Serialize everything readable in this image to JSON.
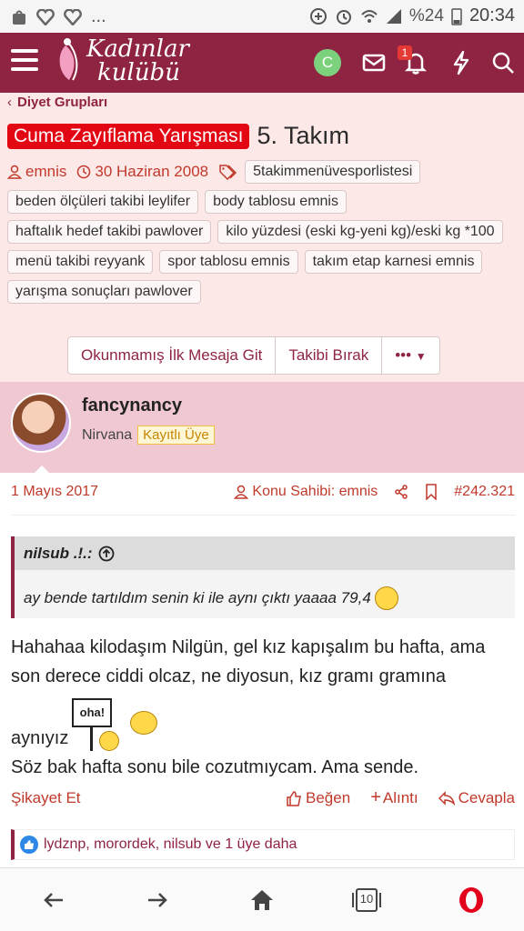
{
  "status_bar": {
    "battery": "%24",
    "time": "20:34"
  },
  "app": {
    "logo_line1": "Kadınlar",
    "logo_line2": "kulübü",
    "avatar_letter": "C",
    "notification_count": "1"
  },
  "breadcrumb": "Diyet Grupları",
  "thread": {
    "prefix": "Cuma Zayıflama Yarışması",
    "title": "5. Takım",
    "author": "emnis",
    "date": "30 Haziran 2008",
    "tags": [
      "5takimmenüvesporlistesi",
      "beden ölçüleri takibi leylifer",
      "body tablosu emnis",
      "haftalık hedef takibi pawlover",
      "kilo yüzdesi (eski kg-yeni kg)/eski kg *100",
      "menü takibi reyyank",
      "spor tablosu emnis",
      "takım etap karnesi emnis",
      "yarışma sonuçları pawlover"
    ],
    "buttons": {
      "unread": "Okunmamış İlk Mesaja Git",
      "unwatch": "Takibi Bırak",
      "more": "•••"
    }
  },
  "post": {
    "username": "fancynancy",
    "user_title": "Nirvana",
    "user_badge": "Kayıtlı Üye",
    "date": "1 Mayıs 2017",
    "thread_starter": "Konu Sahibi: emnis",
    "post_number": "#242.321",
    "quote_author": "nilsub .!.:",
    "quote_text": "ay bende tartıldım senin ki ile aynı çıktı yaaaa 79,4",
    "body_line1": "Hahahaa kilodaşım Nilgün, gel kız kapışalım bu hafta, ama son derece ciddi olcaz, ne diyosun, kız gramı gramına",
    "body_line2": "aynıyız",
    "body_line3": "Söz bak hafta sonu bile cozutmıycam. Ama sende.",
    "sign_text": "oha!",
    "report": "Şikayet Et",
    "like": "Beğen",
    "quote_btn": "Alıntı",
    "reply": "Cevapla",
    "likes_text": "lydznp, morordek, nilsub ve 1 üye daha"
  },
  "browser": {
    "tabs_count": "10"
  }
}
